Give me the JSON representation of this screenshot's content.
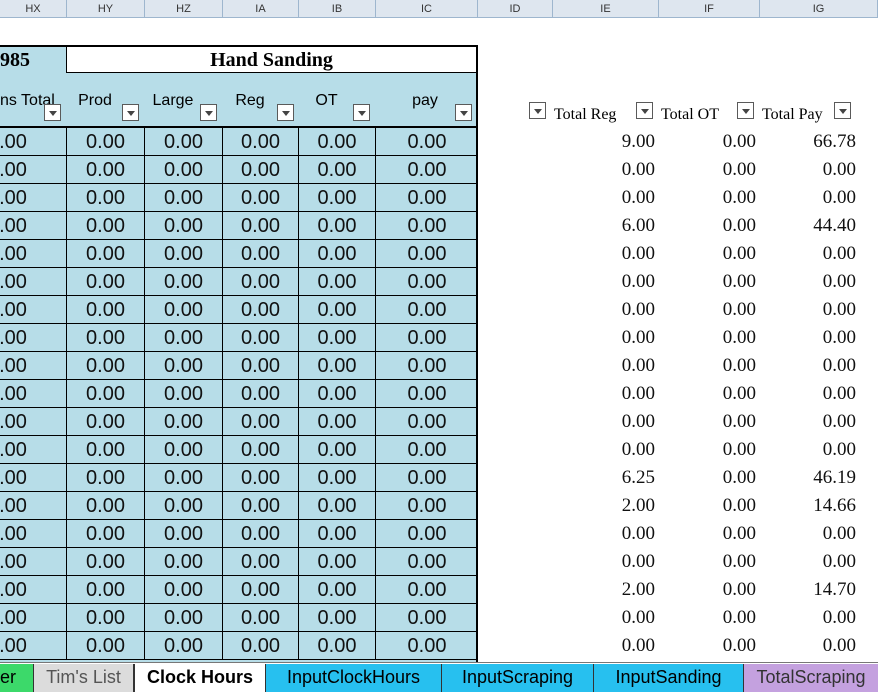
{
  "column_letters": [
    "HX",
    "HY",
    "HZ",
    "IA",
    "IB",
    "IC",
    "ID",
    "IE",
    "IF",
    "IG"
  ],
  "left_header_fragment": "985",
  "group_header": "Hand Sanding",
  "sub_headers": [
    "ns Total",
    "Prod",
    "Large",
    "Reg",
    "OT",
    "pay"
  ],
  "right_headers": [
    "Total Reg",
    "Total OT",
    "Total Pay"
  ],
  "left_values": [
    [
      "0.00",
      "0.00",
      "0.00",
      "0.00",
      "0.00",
      "0.00"
    ],
    [
      "0.00",
      "0.00",
      "0.00",
      "0.00",
      "0.00",
      "0.00"
    ],
    [
      "0.00",
      "0.00",
      "0.00",
      "0.00",
      "0.00",
      "0.00"
    ],
    [
      "0.00",
      "0.00",
      "0.00",
      "0.00",
      "0.00",
      "0.00"
    ],
    [
      "0.00",
      "0.00",
      "0.00",
      "0.00",
      "0.00",
      "0.00"
    ],
    [
      "0.00",
      "0.00",
      "0.00",
      "0.00",
      "0.00",
      "0.00"
    ],
    [
      "0.00",
      "0.00",
      "0.00",
      "0.00",
      "0.00",
      "0.00"
    ],
    [
      "0.00",
      "0.00",
      "0.00",
      "0.00",
      "0.00",
      "0.00"
    ],
    [
      "0.00",
      "0.00",
      "0.00",
      "0.00",
      "0.00",
      "0.00"
    ],
    [
      "0.00",
      "0.00",
      "0.00",
      "0.00",
      "0.00",
      "0.00"
    ],
    [
      "0.00",
      "0.00",
      "0.00",
      "0.00",
      "0.00",
      "0.00"
    ],
    [
      "0.00",
      "0.00",
      "0.00",
      "0.00",
      "0.00",
      "0.00"
    ],
    [
      "0.00",
      "0.00",
      "0.00",
      "0.00",
      "0.00",
      "0.00"
    ],
    [
      "0.00",
      "0.00",
      "0.00",
      "0.00",
      "0.00",
      "0.00"
    ],
    [
      "0.00",
      "0.00",
      "0.00",
      "0.00",
      "0.00",
      "0.00"
    ],
    [
      "0.00",
      "0.00",
      "0.00",
      "0.00",
      "0.00",
      "0.00"
    ],
    [
      "0.00",
      "0.00",
      "0.00",
      "0.00",
      "0.00",
      "0.00"
    ],
    [
      "0.00",
      "0.00",
      "0.00",
      "0.00",
      "0.00",
      "0.00"
    ],
    [
      "0.00",
      "0.00",
      "0.00",
      "0.00",
      "0.00",
      "0.00"
    ]
  ],
  "right_values": [
    [
      "9.00",
      "0.00",
      "66.78"
    ],
    [
      "0.00",
      "0.00",
      "0.00"
    ],
    [
      "0.00",
      "0.00",
      "0.00"
    ],
    [
      "6.00",
      "0.00",
      "44.40"
    ],
    [
      "0.00",
      "0.00",
      "0.00"
    ],
    [
      "0.00",
      "0.00",
      "0.00"
    ],
    [
      "0.00",
      "0.00",
      "0.00"
    ],
    [
      "0.00",
      "0.00",
      "0.00"
    ],
    [
      "0.00",
      "0.00",
      "0.00"
    ],
    [
      "0.00",
      "0.00",
      "0.00"
    ],
    [
      "0.00",
      "0.00",
      "0.00"
    ],
    [
      "0.00",
      "0.00",
      "0.00"
    ],
    [
      "6.25",
      "0.00",
      "46.19"
    ],
    [
      "2.00",
      "0.00",
      "14.66"
    ],
    [
      "0.00",
      "0.00",
      "0.00"
    ],
    [
      "0.00",
      "0.00",
      "0.00"
    ],
    [
      "2.00",
      "0.00",
      "14.70"
    ],
    [
      "0.00",
      "0.00",
      "0.00"
    ],
    [
      "0.00",
      "0.00",
      "0.00"
    ]
  ],
  "sheet_tabs": [
    "er",
    "Tim's List",
    "Clock Hours",
    "InputClockHours",
    "InputScraping",
    "InputSanding",
    "TotalScraping"
  ],
  "active_tab": "Clock Hours",
  "colors": {
    "cell_blue": "#b7dde8",
    "tab_green": "#3cd96a",
    "tab_gray": "#dcdcdc",
    "tab_white": "#ffffff",
    "tab_cyan": "#27c0ef",
    "tab_purple": "#c4a1df"
  }
}
